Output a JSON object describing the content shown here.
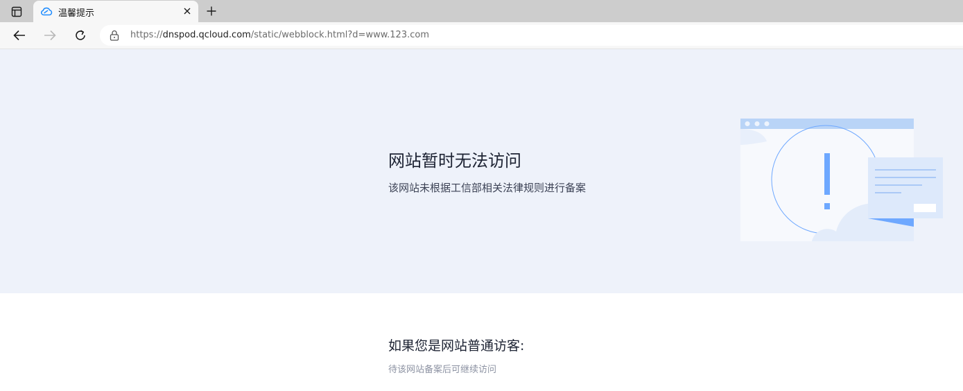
{
  "browser": {
    "tab": {
      "title": "温馨提示",
      "favicon": "cloud-icon"
    },
    "actions": {
      "tab_actions_icon": "tab-actions-icon",
      "close_icon": "close-icon",
      "new_tab_icon": "plus-icon",
      "back_icon": "arrow-left-icon",
      "forward_icon": "arrow-right-icon",
      "refresh_icon": "refresh-icon",
      "lock_icon": "lock-icon"
    },
    "address": {
      "scheme": "https://",
      "host": "dnspod.qcloud.com",
      "path": "/static/webblock.html?d=www.123.com"
    }
  },
  "page": {
    "title": "网站暂时无法访问",
    "subtitle": "该网站未根据工信部相关法律规则进行备案",
    "visitor_heading": "如果您是网站普通访客:",
    "visitor_note": "待该网站备案后可继续访问",
    "illustration": "browser-warning-illustration"
  },
  "colors": {
    "hero_background": "#eef2fa",
    "accent_blue": "#6ea8ff",
    "favicon_blue": "#1e8cff"
  }
}
